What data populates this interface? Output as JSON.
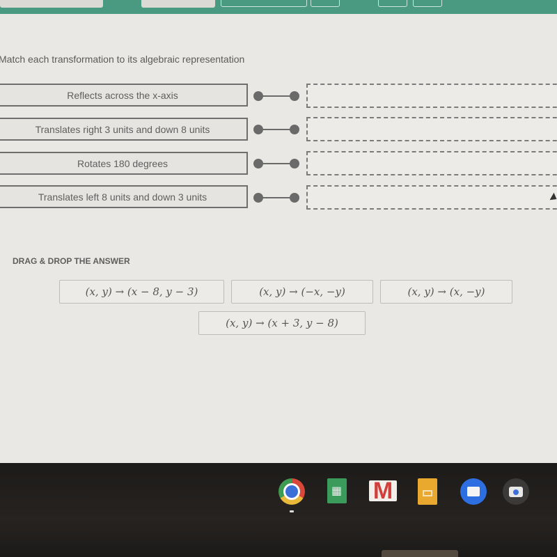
{
  "header": {
    "toolbar_buttons": [
      {
        "style": "solid"
      },
      {
        "style": "solid"
      },
      {
        "style": "outline"
      },
      {
        "style": "outline"
      },
      {
        "style": "outline"
      },
      {
        "style": "outline"
      }
    ]
  },
  "question": {
    "instructions": "Match each transformation to its algebraic representation",
    "prompts": [
      {
        "label": "Reflects across the x-axis",
        "answer": ""
      },
      {
        "label": "Translates right 3 units and down 8 units",
        "answer": ""
      },
      {
        "label": "Rotates 180 degrees",
        "answer": ""
      },
      {
        "label": "Translates left 8 units and down 3 units",
        "answer": ""
      }
    ]
  },
  "answer_bank": {
    "title": "DRAG & DROP THE ANSWER",
    "options": [
      "(x, y) → (x − 8, y − 3)",
      "(x, y) → (−x, −y)",
      "(x, y) → (x, −y)",
      "(x, y) → (x + 3, y − 8)"
    ]
  },
  "shelf": {
    "apps": [
      "Chrome",
      "Sheets",
      "Gmail",
      "Slides",
      "Files",
      "Camera"
    ]
  },
  "colors": {
    "header_green": "#4a9a82",
    "page_bg": "#e9e8e4",
    "shelf_bg": "#1d1b19"
  }
}
